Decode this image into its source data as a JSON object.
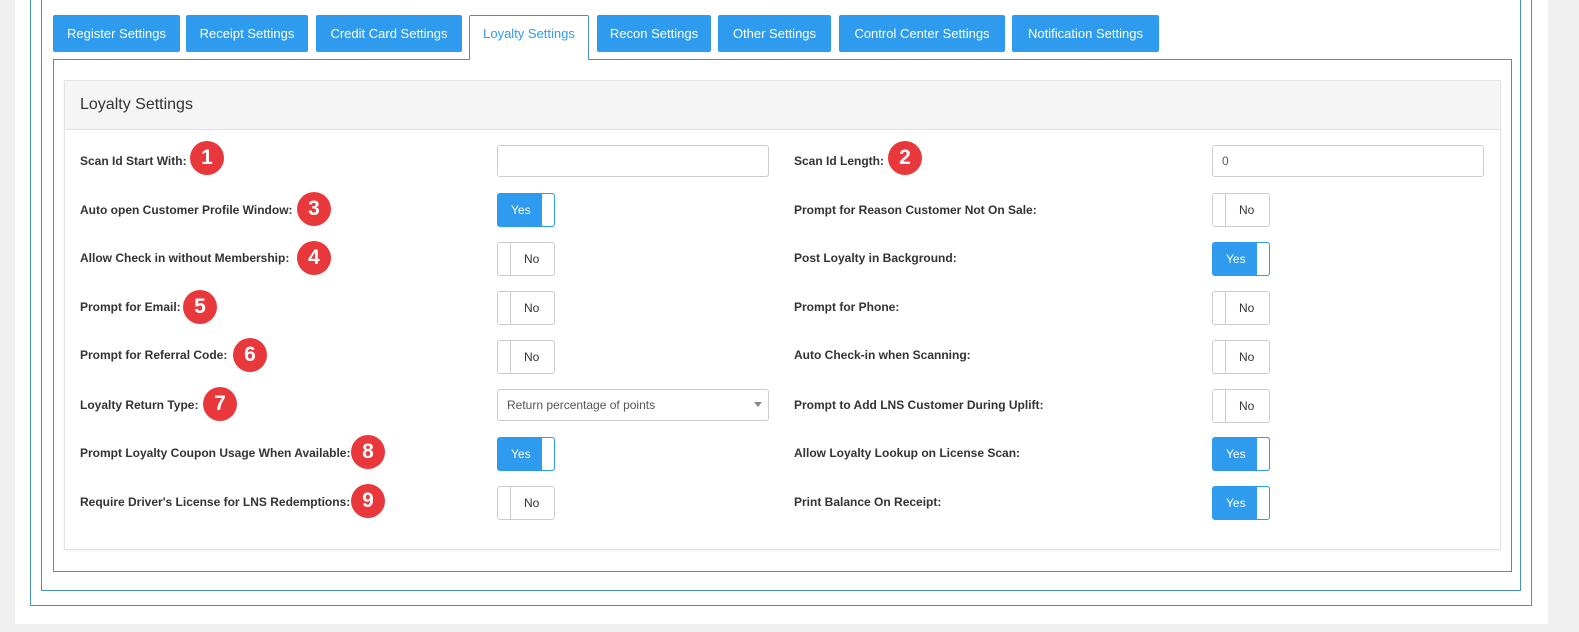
{
  "tabs": [
    {
      "label": "Register Settings",
      "active": false
    },
    {
      "label": "Receipt Settings",
      "active": false
    },
    {
      "label": "Credit Card Settings",
      "active": false
    },
    {
      "label": "Loyalty Settings",
      "active": true
    },
    {
      "label": "Recon Settings",
      "active": false
    },
    {
      "label": "Other Settings",
      "active": false
    },
    {
      "label": "Control Center Settings",
      "active": false
    },
    {
      "label": "Notification Settings",
      "active": false
    }
  ],
  "panel": {
    "title": "Loyalty Settings",
    "left": [
      {
        "label": "Scan Id Start With:",
        "badge": "1",
        "control": "text",
        "value": ""
      },
      {
        "label": "Auto open Customer Profile Window:",
        "badge": "3",
        "control": "toggle",
        "value": "Yes"
      },
      {
        "label": "Allow Check in without Membership:",
        "badge": "4",
        "control": "toggle",
        "value": "No"
      },
      {
        "label": "Prompt for Email:",
        "badge": "5",
        "control": "toggle",
        "value": "No"
      },
      {
        "label": "Prompt for Referral Code:",
        "badge": "6",
        "control": "toggle",
        "value": "No"
      },
      {
        "label": "Loyalty Return Type:",
        "badge": "7",
        "control": "select",
        "value": "Return percentage of points"
      },
      {
        "label": "Prompt Loyalty Coupon Usage When Available:",
        "badge": "8",
        "control": "toggle",
        "value": "Yes"
      },
      {
        "label": "Require Driver's License for LNS Redemptions:",
        "badge": "9",
        "control": "toggle",
        "value": "No"
      }
    ],
    "right": [
      {
        "label": "Scan Id Length:",
        "badge": "2",
        "control": "text",
        "value": "0"
      },
      {
        "label": "Prompt for Reason Customer Not On Sale:",
        "control": "toggle",
        "value": "No"
      },
      {
        "label": "Post Loyalty in Background:",
        "control": "toggle",
        "value": "Yes"
      },
      {
        "label": "Prompt for Phone:",
        "control": "toggle",
        "value": "No"
      },
      {
        "label": "Auto Check-in when Scanning:",
        "control": "toggle",
        "value": "No"
      },
      {
        "label": "Prompt to Add LNS Customer During Uplift:",
        "control": "toggle",
        "value": "No"
      },
      {
        "label": "Allow Loyalty Lookup on License Scan:",
        "control": "toggle",
        "value": "Yes"
      },
      {
        "label": "Print Balance On Receipt:",
        "control": "toggle",
        "value": "Yes"
      }
    ]
  },
  "colors": {
    "accent": "#2f9bee",
    "frame": "#4a90b8",
    "badge": "#e8383b"
  }
}
